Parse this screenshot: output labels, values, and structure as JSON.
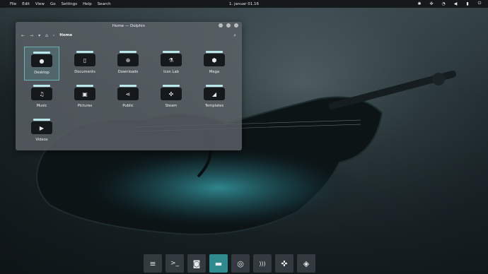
{
  "panel": {
    "menu": [
      "File",
      "Edit",
      "View",
      "Go",
      "Settings",
      "Help",
      "Search"
    ],
    "clock": "1. januar 01.16",
    "tray_icons": [
      "bluetooth-icon",
      "gamepad-icon",
      "wifi-icon",
      "volume-icon",
      "battery-icon",
      "power-icon"
    ]
  },
  "window": {
    "title": "Home — Dolphin",
    "breadcrumb": "Home",
    "items": [
      {
        "label": "Desktop",
        "icon": "●",
        "selected": true
      },
      {
        "label": "Documents",
        "icon": "▯",
        "selected": false
      },
      {
        "label": "Downloads",
        "icon": "⊕",
        "selected": false
      },
      {
        "label": "Icon Lab",
        "icon": "⚗",
        "selected": false
      },
      {
        "label": "Mega",
        "icon": "⬢",
        "selected": false
      },
      {
        "label": "Music",
        "icon": "♫",
        "selected": false
      },
      {
        "label": "Pictures",
        "icon": "▣",
        "selected": false
      },
      {
        "label": "Public",
        "icon": "⋖",
        "selected": false
      },
      {
        "label": "Steam",
        "icon": "✜",
        "selected": false
      },
      {
        "label": "Templates",
        "icon": "◢",
        "selected": false
      },
      {
        "label": "Videos",
        "icon": "▶",
        "selected": false
      }
    ]
  },
  "dock": [
    {
      "icon": "≡",
      "name": "mixer"
    },
    {
      "icon": ">_",
      "name": "terminal"
    },
    {
      "icon": "◙",
      "name": "briefcase"
    },
    {
      "icon": "▬",
      "name": "files",
      "active": true
    },
    {
      "icon": "◎",
      "name": "chrome"
    },
    {
      "icon": ")))",
      "name": "podcast"
    },
    {
      "icon": "✜",
      "name": "games"
    },
    {
      "icon": "◈",
      "name": "stack"
    }
  ]
}
